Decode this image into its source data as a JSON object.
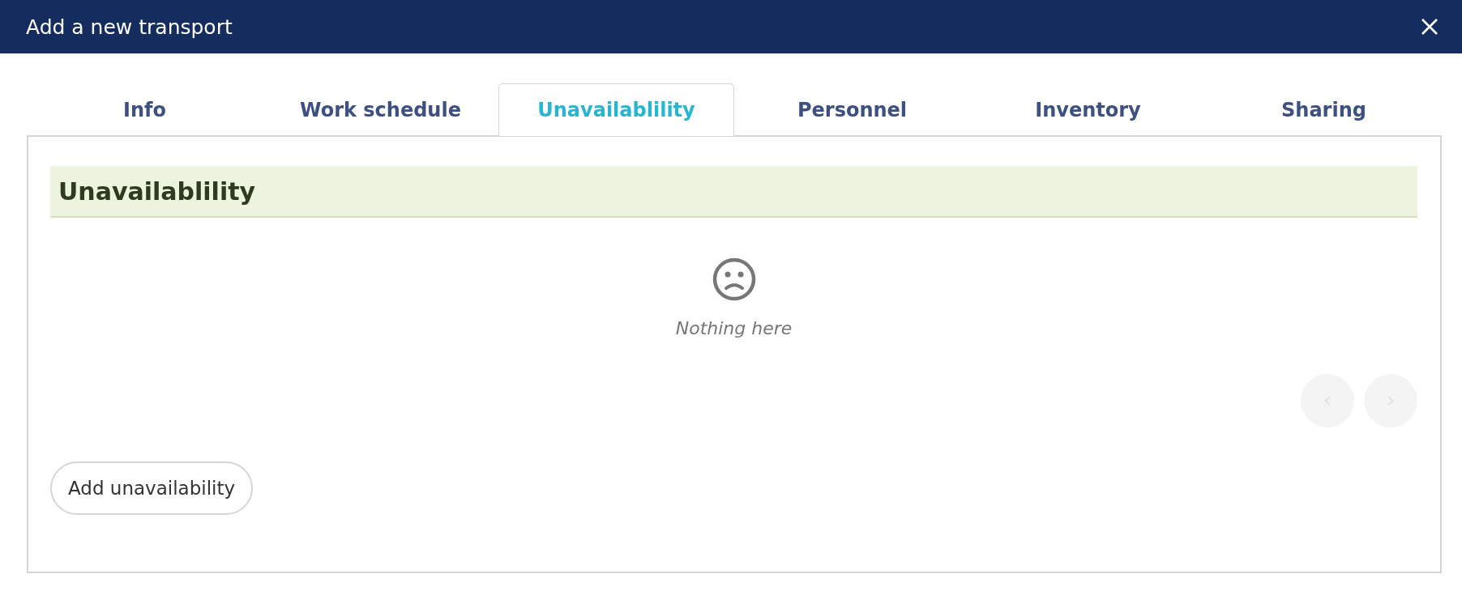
{
  "window": {
    "title": "Add a new transport"
  },
  "tabs": [
    {
      "label": "Info",
      "selected": false
    },
    {
      "label": "Work schedule",
      "selected": false
    },
    {
      "label": "Unavailablility",
      "selected": true
    },
    {
      "label": "Personnel",
      "selected": false
    },
    {
      "label": "Inventory",
      "selected": false
    },
    {
      "label": "Sharing",
      "selected": false
    }
  ],
  "section": {
    "title": "Unavailablility",
    "empty_message": "Nothing here"
  },
  "pager": {
    "previous": {
      "disabled": true
    },
    "next": {
      "disabled": true
    }
  },
  "buttons": [
    {
      "label": "Add unavailability"
    }
  ]
}
